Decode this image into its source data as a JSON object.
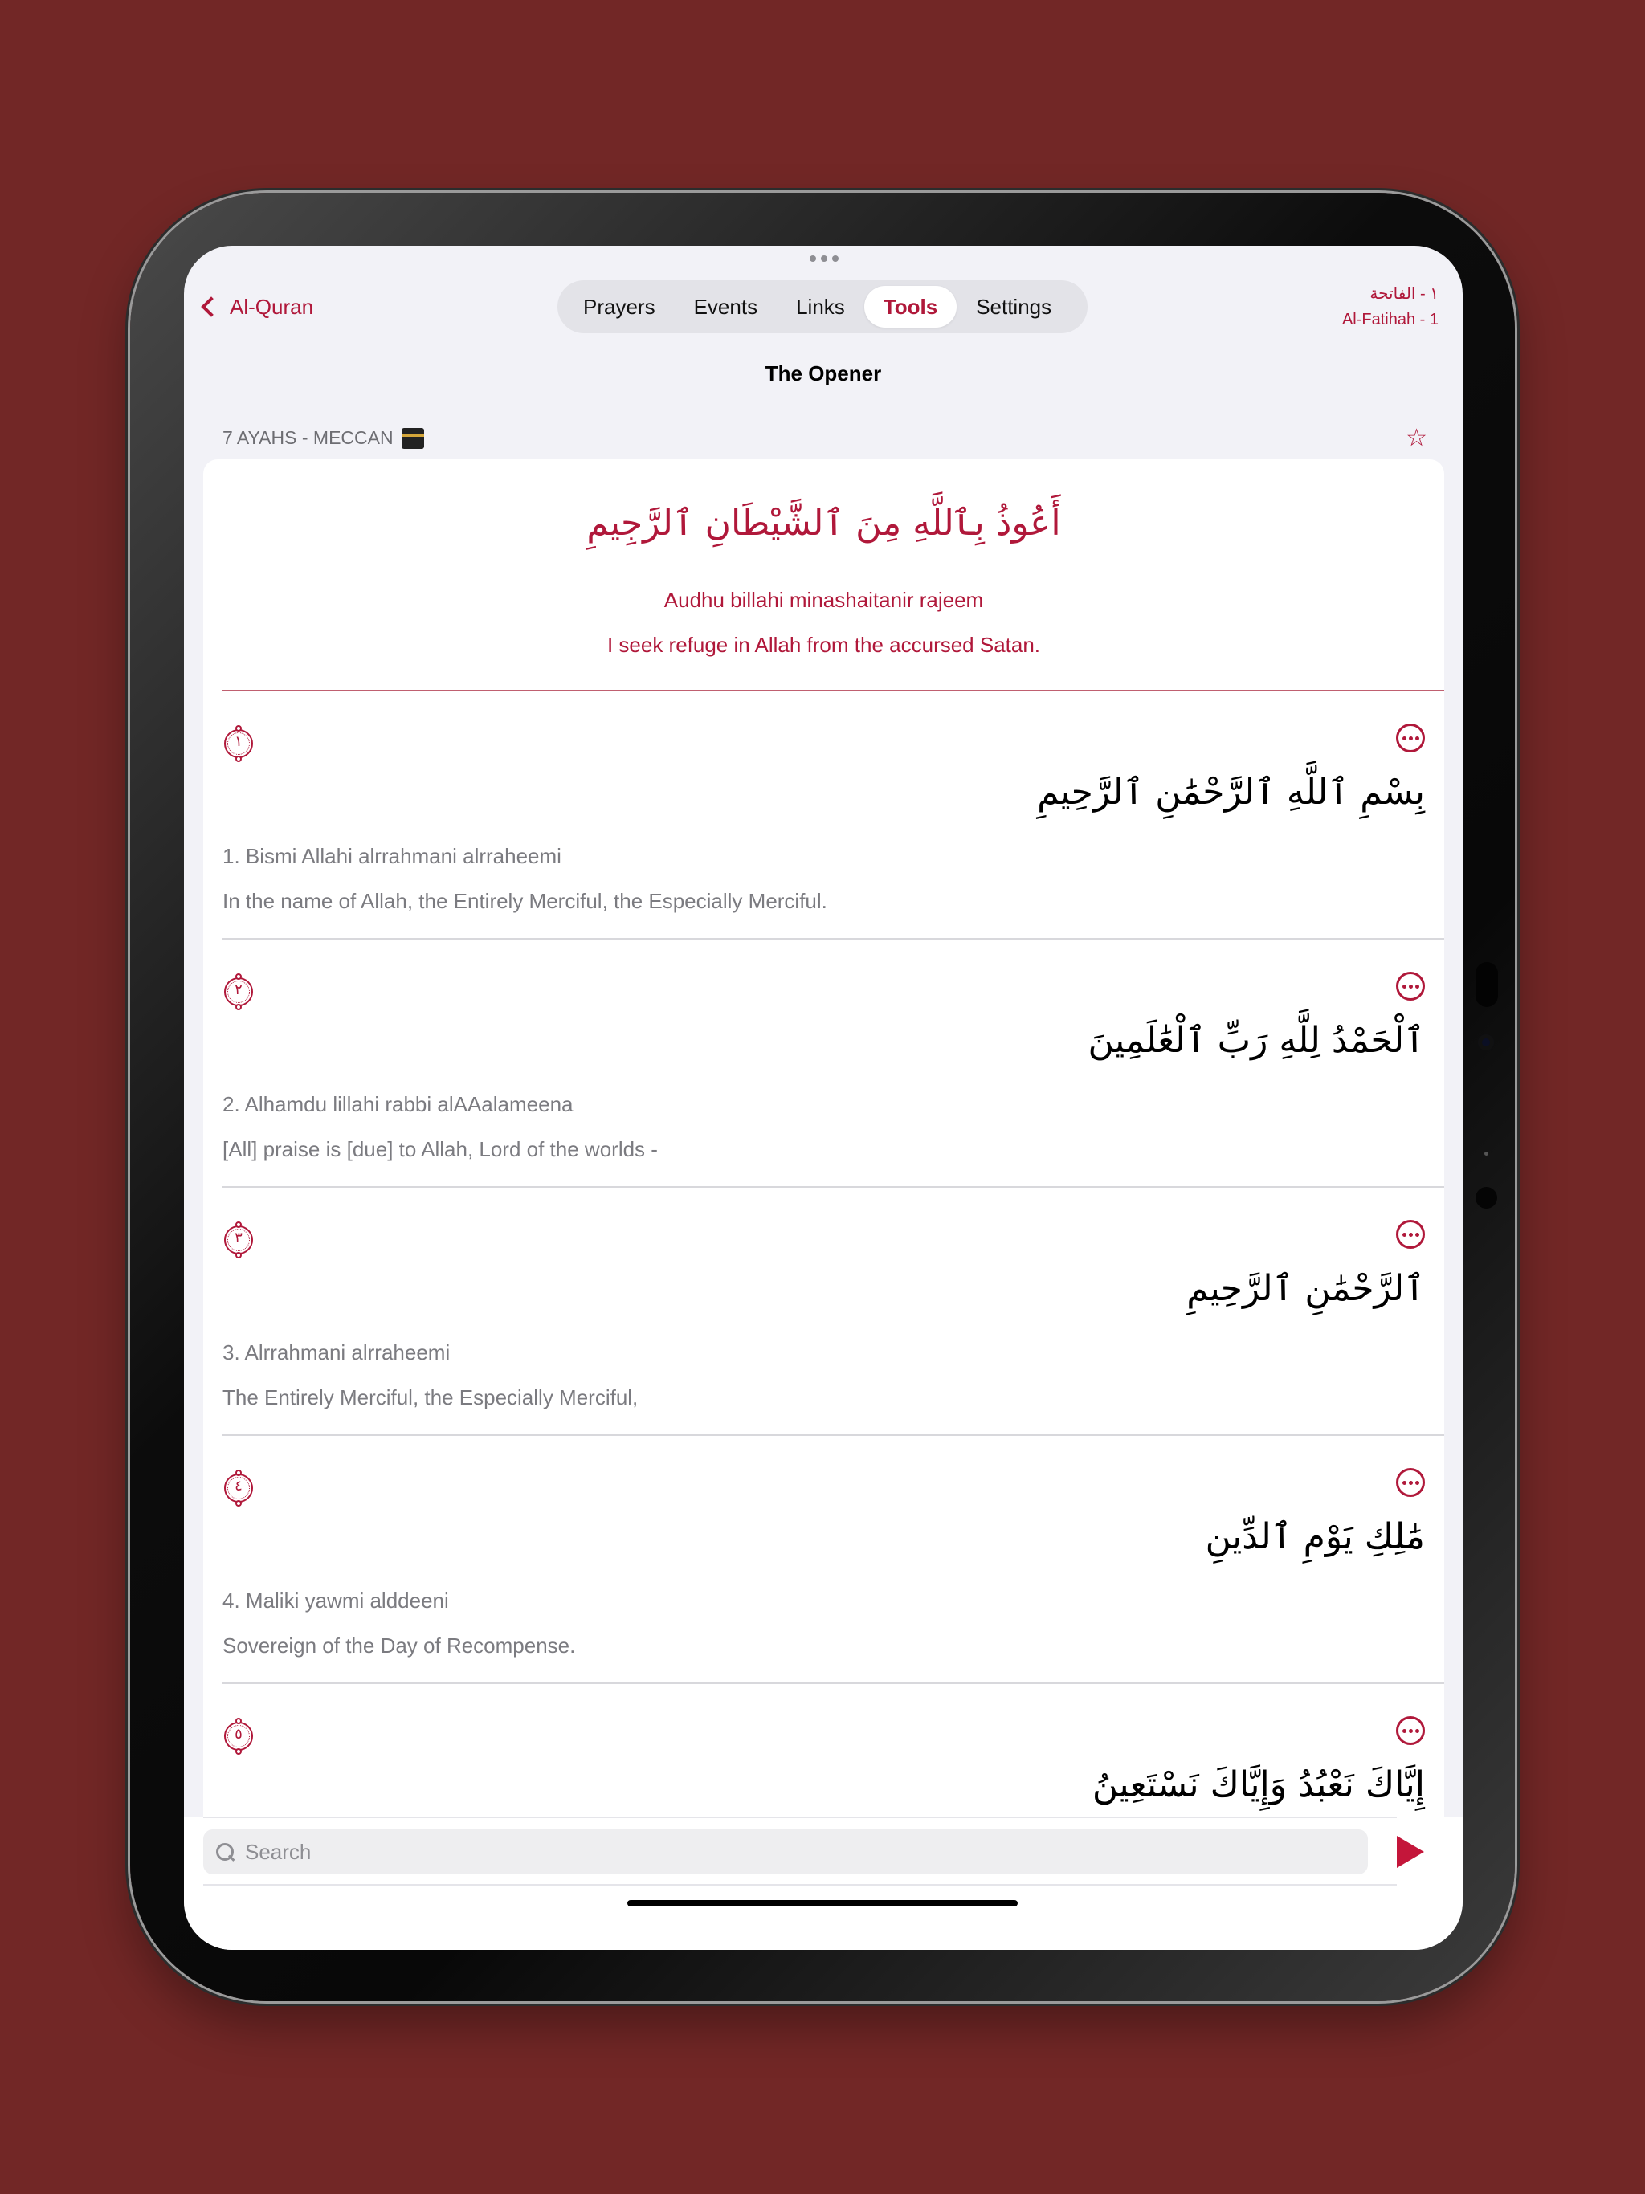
{
  "nav": {
    "back_label": "Al-Quran",
    "tabs": [
      {
        "label": "Prayers",
        "active": false
      },
      {
        "label": "Events",
        "active": false
      },
      {
        "label": "Links",
        "active": false
      },
      {
        "label": "Tools",
        "active": true
      },
      {
        "label": "Settings",
        "active": false
      }
    ],
    "surah_arabic": "١ - الفاتحة",
    "surah_english": "Al-Fatihah - 1"
  },
  "title": "The Opener",
  "section": {
    "header": "7 AYAHS - MECCAN",
    "header_icon": "kaaba-icon",
    "bookmark_icon": "star-icon"
  },
  "istiadha": {
    "arabic": "أَعُوذُ بِٱللَّهِ مِنَ ٱلشَّيْطَانِ ٱلرَّجِيمِ",
    "transliteration": "Audhu billahi minashaitanir rajeem",
    "translation": "I seek refuge in Allah from the accursed Satan."
  },
  "ayahs": [
    {
      "number": "١",
      "arabic": "بِسْمِ ٱللَّهِ ٱلرَّحْمَٰنِ ٱلرَّحِيمِ",
      "transliteration": "1. Bismi Allahi alrrahmani alrraheemi",
      "translation": "In the name of Allah, the Entirely Merciful, the Especially Merciful."
    },
    {
      "number": "٢",
      "arabic": "ٱلْحَمْدُ لِلَّهِ رَبِّ ٱلْعَٰلَمِينَ",
      "transliteration": "2. Alhamdu lillahi rabbi alAAalameena",
      "translation": "[All] praise is [due] to Allah, Lord of the worlds -"
    },
    {
      "number": "٣",
      "arabic": "ٱلرَّحْمَٰنِ ٱلرَّحِيمِ",
      "transliteration": "3. Alrrahmani alrraheemi",
      "translation": "The Entirely Merciful, the Especially Merciful,"
    },
    {
      "number": "٤",
      "arabic": "مَٰلِكِ يَوْمِ ٱلدِّينِ",
      "transliteration": "4. Maliki yawmi alddeeni",
      "translation": "Sovereign of the Day of Recompense."
    },
    {
      "number": "٥",
      "arabic": "إِيَّاكَ نَعْبُدُ وَإِيَّاكَ نَسْتَعِينُ",
      "transliteration": "",
      "translation": ""
    }
  ],
  "search": {
    "placeholder": "Search",
    "value": ""
  },
  "colors": {
    "accent": "#b0183a",
    "background": "#722726"
  }
}
